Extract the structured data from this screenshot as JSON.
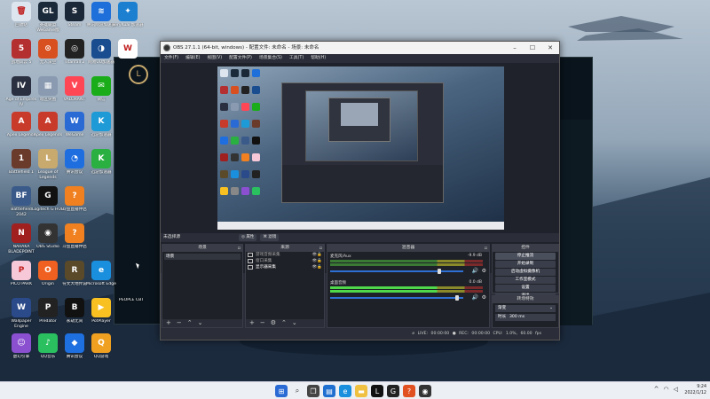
{
  "desktop": {
    "icons": [
      {
        "label": "回收站",
        "color": "#dde6ef",
        "glyph": "🗑"
      },
      {
        "label": "英雄联盟 WeGame版",
        "color": "#1a2a3a",
        "glyph": "GL"
      },
      {
        "label": "Steam",
        "color": "#1b2838",
        "glyph": "S"
      },
      {
        "label": "腾讯网游加速器",
        "color": "#1e6fd9",
        "glyph": "≋"
      },
      {
        "label": "VeryKuai 加速器",
        "color": "#1c7fd0",
        "glyph": "✦"
      },
      {
        "label": "战地风云 5",
        "color": "#b43030",
        "glyph": "5"
      },
      {
        "label": "无人深空",
        "color": "#d85020",
        "glyph": "⊙"
      },
      {
        "label": "Titanfall 2",
        "color": "#222",
        "glyph": "◎"
      },
      {
        "label": "网易UU加速器",
        "color": "#1a4d90",
        "glyph": "◑"
      },
      {
        "label": "",
        "color": "#fff",
        "glyph": "W"
      },
      {
        "label": "Age of Empires IV",
        "color": "#2a3040",
        "glyph": "IV"
      },
      {
        "label": "暗区突围",
        "color": "#8a9ab0",
        "glyph": "▦"
      },
      {
        "label": "VALORANT",
        "color": "#ff4655",
        "glyph": "V"
      },
      {
        "label": "微信",
        "color": "#1aad19",
        "glyph": "✉"
      },
      {
        "label": "Apex Legends",
        "color": "#c83a2a",
        "glyph": "A"
      },
      {
        "label": "Apex Legends",
        "color": "#c83a2a",
        "glyph": "A"
      },
      {
        "label": "WeGame",
        "color": "#2a6ad4",
        "glyph": "W"
      },
      {
        "label": "迅游加速器",
        "color": "#1e9ad6",
        "glyph": "K"
      },
      {
        "label": "Battlefield 1",
        "color": "#6a3a2a",
        "glyph": "1"
      },
      {
        "label": "League of Legends",
        "color": "#c8aa6e",
        "glyph": "L"
      },
      {
        "label": "腾讯会议",
        "color": "#1f6ee0",
        "glyph": "◔"
      },
      {
        "label": "迅游加速器",
        "color": "#2ab040",
        "glyph": "K"
      },
      {
        "label": "Battlefield 2042",
        "color": "#3a5a8a",
        "glyph": "BF"
      },
      {
        "label": "Logitech G HUB",
        "color": "#111",
        "glyph": "G"
      },
      {
        "label": "斗鱼直播伴侣",
        "color": "#f08020",
        "glyph": "?"
      },
      {
        "label": "NARAKA BLADEPOINT",
        "color": "#a02020",
        "glyph": "N"
      },
      {
        "label": "OBS Studio",
        "color": "#333",
        "glyph": "◉"
      },
      {
        "label": "斗鱼直播伴侣",
        "color": "#f08020",
        "glyph": "?"
      },
      {
        "label": "PICO PARK",
        "color": "#f7c8d8",
        "glyph": "P"
      },
      {
        "label": "Origin",
        "color": "#f06020",
        "glyph": "O"
      },
      {
        "label": "符文大地传说",
        "color": "#5a4a2a",
        "glyph": "R"
      },
      {
        "label": "Microsoft Edge",
        "color": "#1a8fdd",
        "glyph": "e"
      },
      {
        "label": "Wallpaper Engine",
        "color": "#2a4a8a",
        "glyph": "W"
      },
      {
        "label": "Predator",
        "color": "#222",
        "glyph": "P"
      },
      {
        "label": "永劫无间",
        "color": "#111",
        "glyph": "B"
      },
      {
        "label": "PotPlayer",
        "color": "#f8c020",
        "glyph": "▶"
      },
      {
        "label": "PEOPLE CBT",
        "color": "",
        "glyph": ""
      },
      {
        "label": "虚幻引擎",
        "color": "#8a50d0",
        "glyph": "☺"
      },
      {
        "label": "QQ音乐",
        "color": "#2ac060",
        "glyph": "♪"
      },
      {
        "label": "腾讯会议",
        "color": "#1e6fe0",
        "glyph": "◆"
      },
      {
        "label": "QQ游戏",
        "color": "#f0a020",
        "glyph": "Q"
      }
    ]
  },
  "obs": {
    "title": "OBS 27.1.1 (64-bit, windows) - 配置文件: 未命名 - 场景: 未命名",
    "menu": [
      "文件(F)",
      "编辑(E)",
      "视图(V)",
      "配置文件(P)",
      "场景集合(S)",
      "工具(T)",
      "帮助(H)"
    ],
    "scene_bar_label": "未选择源",
    "filter_btn_1": "◎ 属性",
    "filter_btn_2": "⌘ 滤镜",
    "scenes": {
      "title": "场景",
      "items": [
        "场景"
      ]
    },
    "sources": {
      "title": "来源",
      "items": [
        {
          "label": "游戏音频采集"
        },
        {
          "label": "窗口采集"
        },
        {
          "label": "显示器采集"
        }
      ]
    },
    "mixer": {
      "title": "混音器",
      "channels": [
        {
          "name": "麦克风/Aux",
          "db": "-9.9 dB",
          "fader": 0.82
        },
        {
          "name": "桌面音频",
          "db": "0.0 dB",
          "fader": 0.95
        }
      ]
    },
    "controls": {
      "title": "控件",
      "buttons": [
        "停止推流",
        "开始录制",
        "启动虚拟摄像机",
        "工作室模式",
        "设置",
        "退出"
      ]
    },
    "transitions": {
      "title": "转场特效",
      "selected": "渐变",
      "duration_label": "时长",
      "duration": "300 ms"
    },
    "status": "⌀ LIVE: 00:00:00   ● REC: 00:00:00   CPU: 1.0%, 60.00 fps"
  },
  "taskbar": {
    "time": "9:24",
    "date": "2022/1/12"
  }
}
